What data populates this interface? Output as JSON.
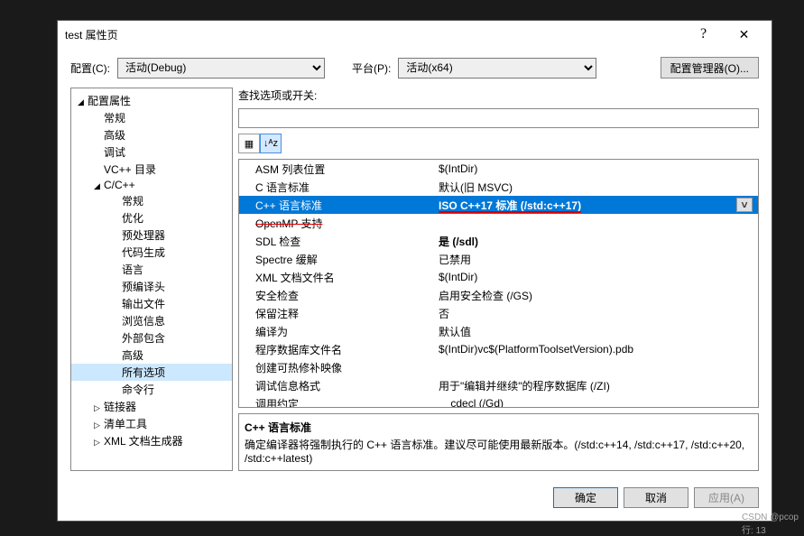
{
  "titlebar": {
    "title": "test 属性页",
    "help": "?",
    "close": "✕"
  },
  "config": {
    "config_label": "配置(C):",
    "config_value": "活动(Debug)",
    "platform_label": "平台(P):",
    "platform_value": "活动(x64)",
    "manager_btn": "配置管理器(O)..."
  },
  "tree": [
    {
      "lv": 0,
      "exp": "◢",
      "label": "配置属性"
    },
    {
      "lv": 1,
      "label": "常规"
    },
    {
      "lv": 1,
      "label": "高级"
    },
    {
      "lv": 1,
      "label": "调试"
    },
    {
      "lv": 1,
      "label": "VC++ 目录"
    },
    {
      "lv": 1,
      "exp": "◢",
      "label": "C/C++"
    },
    {
      "lv": 2,
      "label": "常规"
    },
    {
      "lv": 2,
      "label": "优化"
    },
    {
      "lv": 2,
      "label": "预处理器"
    },
    {
      "lv": 2,
      "label": "代码生成"
    },
    {
      "lv": 2,
      "label": "语言"
    },
    {
      "lv": 2,
      "label": "预编译头"
    },
    {
      "lv": 2,
      "label": "输出文件"
    },
    {
      "lv": 2,
      "label": "浏览信息"
    },
    {
      "lv": 2,
      "label": "外部包含"
    },
    {
      "lv": 2,
      "label": "高级"
    },
    {
      "lv": 2,
      "label": "所有选项",
      "sel": true
    },
    {
      "lv": 2,
      "label": "命令行"
    },
    {
      "lv": 1,
      "exp": "▷",
      "label": "链接器"
    },
    {
      "lv": 1,
      "exp": "▷",
      "label": "清单工具"
    },
    {
      "lv": 1,
      "exp": "▷",
      "label": "XML 文档生成器"
    }
  ],
  "search_label": "查找选项或开关:",
  "search_value": "",
  "view_tools": {
    "cat": "▦",
    "sort": "↓ᴬᴢ"
  },
  "grid": [
    {
      "name": "ASM 列表位置",
      "val": "$(IntDir)"
    },
    {
      "name": "C 语言标准",
      "val": "默认(旧 MSVC)"
    },
    {
      "name": "C++ 语言标准",
      "val": "ISO C++17 标准 (/std:c++17)",
      "sel": true,
      "bold": true,
      "red": true
    },
    {
      "name": "OpenMP 支持",
      "val": "",
      "strike": true
    },
    {
      "name": "SDL 检查",
      "val": "是 (/sdl)",
      "bold": true
    },
    {
      "name": "Spectre 缓解",
      "val": "已禁用"
    },
    {
      "name": "XML 文档文件名",
      "val": "$(IntDir)"
    },
    {
      "name": "安全检查",
      "val": "启用安全检查 (/GS)"
    },
    {
      "name": "保留注释",
      "val": "否"
    },
    {
      "name": "编译为",
      "val": "默认值"
    },
    {
      "name": "程序数据库文件名",
      "val": "$(IntDir)vc$(PlatformToolsetVersion).pdb"
    },
    {
      "name": "创建可热修补映像",
      "val": ""
    },
    {
      "name": "调试信息格式",
      "val": "用于\"编辑并继续\"的程序数据库 (/ZI)"
    },
    {
      "name": "调用约定",
      "val": "__cdecl (/Gd)"
    }
  ],
  "desc": {
    "title": "C++ 语言标准",
    "text": "确定编译器将强制执行的 C++ 语言标准。建议尽可能使用最新版本。(/std:c++14, /std:c++17, /std:c++20, /std:c++latest)"
  },
  "footer": {
    "ok": "确定",
    "cancel": "取消",
    "apply": "应用(A)"
  },
  "statusbar": {
    "watermark": "CSDN @pcop",
    "line": "行: 13"
  }
}
